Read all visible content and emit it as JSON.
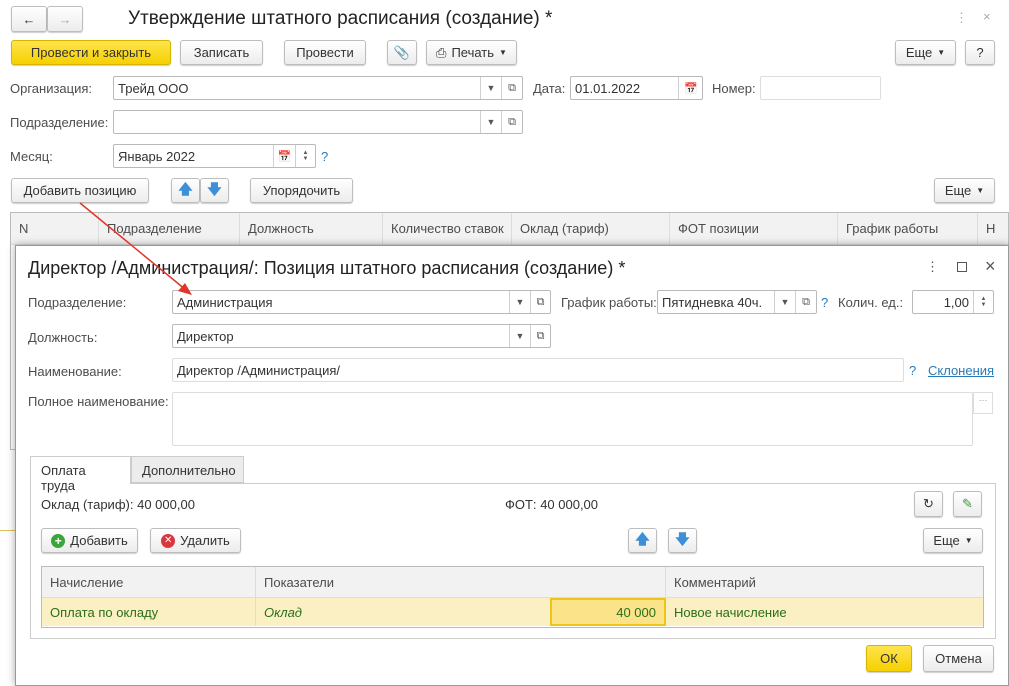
{
  "main": {
    "title": "Утверждение штатного расписания (создание) *",
    "toolbar": {
      "post_close": "Провести и закрыть",
      "save": "Записать",
      "post": "Провести",
      "print": "Печать",
      "more": "Еще",
      "help": "?"
    },
    "org_label": "Организация:",
    "org_value": "Трейд ООО",
    "date_label": "Дата:",
    "date_value": "01.01.2022",
    "number_label": "Номер:",
    "number_value": "",
    "dept_label": "Подразделение:",
    "dept_value": "",
    "month_label": "Месяц:",
    "month_value": "Январь 2022",
    "help": "?",
    "add_position": "Добавить позицию",
    "sort": "Упорядочить",
    "more": "Еще",
    "columns": [
      "N",
      "Подразделение",
      "Должность",
      "Количество ставок",
      "Оклад (тариф)",
      "ФОТ  позиции",
      "График работы",
      "Н"
    ]
  },
  "dialog": {
    "title": "Директор /Администрация/: Позиция штатного расписания (создание) *",
    "dept_label": "Подразделение:",
    "dept_value": "Администрация",
    "schedule_label": "График работы:",
    "schedule_value": "Пятидневка 40ч.",
    "qty_label": "Колич. ед.:",
    "qty_value": "1,00",
    "position_label": "Должность:",
    "position_value": "Директор",
    "name_label": "Наименование:",
    "name_value": "Директор /Администрация/",
    "declension_link": "Склонения",
    "help": "?",
    "fullname_label": "Полное наименование:",
    "fullname_value": "",
    "tabs": [
      "Оплата труда",
      "Дополнительно"
    ],
    "salary_label": "Оклад (тариф):",
    "salary_value": "40 000,00",
    "fot_label": "ФОТ:",
    "fot_value": "40 000,00",
    "add": "Добавить",
    "delete": "Удалить",
    "more": "Еще",
    "columns": [
      "Начисление",
      "Показатели",
      "Комментарий"
    ],
    "rows": [
      {
        "accrual": "Оплата по окладу",
        "indicator": "Оклад",
        "amount": "40 000",
        "comment": "Новое начисление"
      }
    ],
    "ok": "ОК",
    "cancel": "Отмена"
  }
}
